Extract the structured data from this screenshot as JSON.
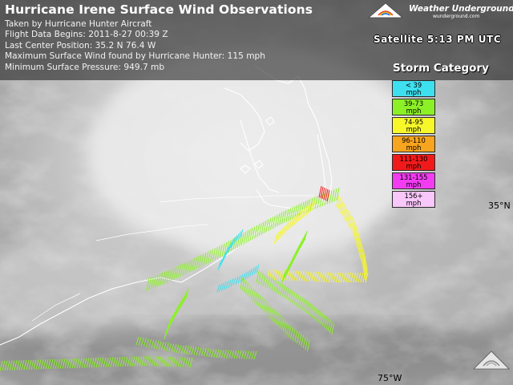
{
  "header": {
    "title": "Hurricane Irene Surface Wind Observations",
    "lines": [
      "Taken by Hurricane Hunter Aircraft",
      "Flight Data Begins: 2011-8-27 00:39 Z",
      "Last Center Position: 35.2 N 76.4 W",
      "Maximum Surface Wind found by Hurricane Hunter: 115 mph",
      "Minimum Surface Pressure: 949.7 mb"
    ]
  },
  "brand": {
    "name": "Weather Underground",
    "sub": "wunderground.com"
  },
  "satellite_label": "Satellite  5:13 PM UTC",
  "legend": {
    "title": "Storm Category",
    "categories": [
      {
        "l1": "< 39",
        "l2": "mph",
        "color": "#3ee0f0"
      },
      {
        "l1": "39-73",
        "l2": "mph",
        "color": "#8cf026"
      },
      {
        "l1": "74-95",
        "l2": "mph",
        "color": "#f7f72a"
      },
      {
        "l1": "96-110",
        "l2": "mph",
        "color": "#f7a41e"
      },
      {
        "l1": "111-130",
        "l2": "mph",
        "color": "#f01a1a"
      },
      {
        "l1": "131-155",
        "l2": "mph",
        "color": "#f23cf2"
      },
      {
        "l1": "156+",
        "l2": "mph",
        "color": "#f9c7f9"
      }
    ]
  },
  "grid_labels": {
    "lat": "35°N",
    "lon": "75°W"
  },
  "colors": {
    "coastline": "#ffffff",
    "cyan": "#3ee0f0",
    "green": "#8cf026",
    "yellow": "#f7f72a",
    "red": "#f01a1a"
  }
}
